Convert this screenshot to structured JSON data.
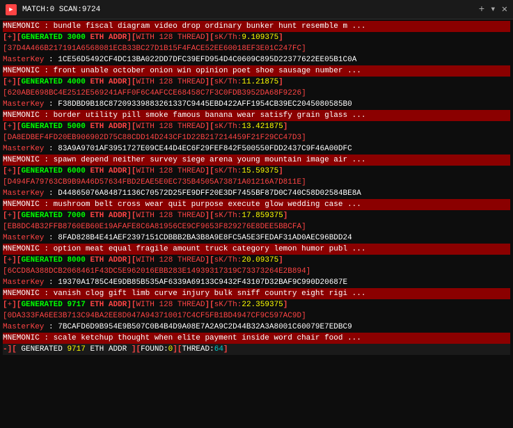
{
  "titleBar": {
    "icon": "▶",
    "title": "MATCH:0 SCAN:9724",
    "close": "✕",
    "plus": "+",
    "caret": "▾"
  },
  "lines": [
    {
      "type": "mnemonic",
      "text": "MNEMONIC : bundle fiscal diagram video drop ordinary bunker hunt resemble m ..."
    },
    {
      "type": "generated",
      "scan": "3000",
      "coin": "ETH",
      "thread": "128",
      "sk": "9.109375",
      "addr": "[37D4A466B217191A6568081ECB33BC27D1B15F4FACE52EE60018EF3E01C247FC]"
    },
    {
      "type": "masterkey",
      "text": "MasterKey : 1CE56D5492CF4DC13BA022DD7DFC39EFD954D4C0609C895D22377622EE05B1C0A"
    },
    {
      "type": "mnemonic",
      "text": "MNEMONIC : front unable october onion win opinion poet shoe sausage number ..."
    },
    {
      "type": "generated",
      "scan": "4000",
      "coin": "ETH",
      "thread": "128",
      "sk": "11.21875",
      "addr": "[620ABE698BC4E2512E569241AFF0F6C4AFCCE68458C7F3C0FDB3952DA68F9226]"
    },
    {
      "type": "masterkey",
      "text": "MasterKey : F38DBD9B18C87209339883261337C9445EBD422AFF1954CB39EC2045080585B0"
    },
    {
      "type": "mnemonic",
      "text": "MNEMONIC : border utility pill smoke famous banana wear satisfy grain glass ..."
    },
    {
      "type": "generated",
      "scan": "5000",
      "coin": "ETH",
      "thread": "128",
      "sk": "13.421875",
      "addr": "[DA8EDBEF4FD20EB906902D75C88CDD14D243CF1D22B217214459F21F29CC47D3]"
    },
    {
      "type": "masterkey",
      "text": "MasterKey : 83A9A9701AF3951727E09CE44D4EC6F29FEF842F500550FDD2437C9F46A00DFC"
    },
    {
      "type": "mnemonic",
      "text": "MNEMONIC : spawn depend neither survey siege arena young mountain image air ..."
    },
    {
      "type": "generated",
      "scan": "6000",
      "coin": "ETH",
      "thread": "128",
      "sk": "15.59375",
      "addr": "[D494FA79763CB9B9A46D57634FBD2EAE5E0EC735B4505A73871A01216A7D811E]"
    },
    {
      "type": "masterkey",
      "text": "MasterKey : D44865076A84871136C70572D25FE9DFF20E3DF7455BF87D0C740C58D02584BE8A"
    },
    {
      "type": "mnemonic",
      "text": "MNEMONIC : mushroom belt cross wear quit purpose execute glow wedding case ..."
    },
    {
      "type": "generated",
      "scan": "7000",
      "coin": "ETH",
      "thread": "128",
      "sk": "17.859375",
      "addr": "[EB8DC4B32FFB8760EB60E19AFAFE8C6A81956CE9CF9653F829276E8DEE5BBCFA]"
    },
    {
      "type": "masterkey",
      "text": "MasterKey : 8FAD828B4E41AEF2397151CDBBB2BA3B8A9E8FC5A5E3FEDAF31AD0AEC96BDD24"
    },
    {
      "type": "mnemonic",
      "text": "MNEMONIC : option meat equal fragile amount truck category lemon humor publ ..."
    },
    {
      "type": "generated",
      "scan": "8000",
      "coin": "ETH",
      "thread": "128",
      "sk": "20.09375",
      "addr": "[6CCD8A388DCB2068461F43DC5E962016EBB283E14939317319C73373264E2B894]"
    },
    {
      "type": "masterkey",
      "text": "MasterKey : 19370A1785C4E9DB85B535AF6339A69133C9432F43107D32BAF9C990D20687E"
    },
    {
      "type": "mnemonic",
      "text": "MNEMONIC : vanish clog gift limb curve injury bulk sniff country eight rigi ..."
    },
    {
      "type": "generated",
      "scan": "9717",
      "coin": "ETH",
      "thread": "128",
      "sk": "22.359375",
      "addr": "[0DA333FA6EE3B713C94BA2EE8D047A943710017C4CF5FB1BD4947CF9C597AC9D]"
    },
    {
      "type": "masterkey",
      "text": "MasterKey : 7BCAFD6D9B954E9B507C0B4B4D9A08E7A2A9C2D44B32A3A8001C60079E7EDBC9"
    },
    {
      "type": "mnemonic",
      "text": "MNEMONIC : scale ketchup thought when elite payment inside word chair food ..."
    },
    {
      "type": "status",
      "scan": "9717",
      "coin": "ETH",
      "found": "0",
      "thread": "64"
    }
  ]
}
